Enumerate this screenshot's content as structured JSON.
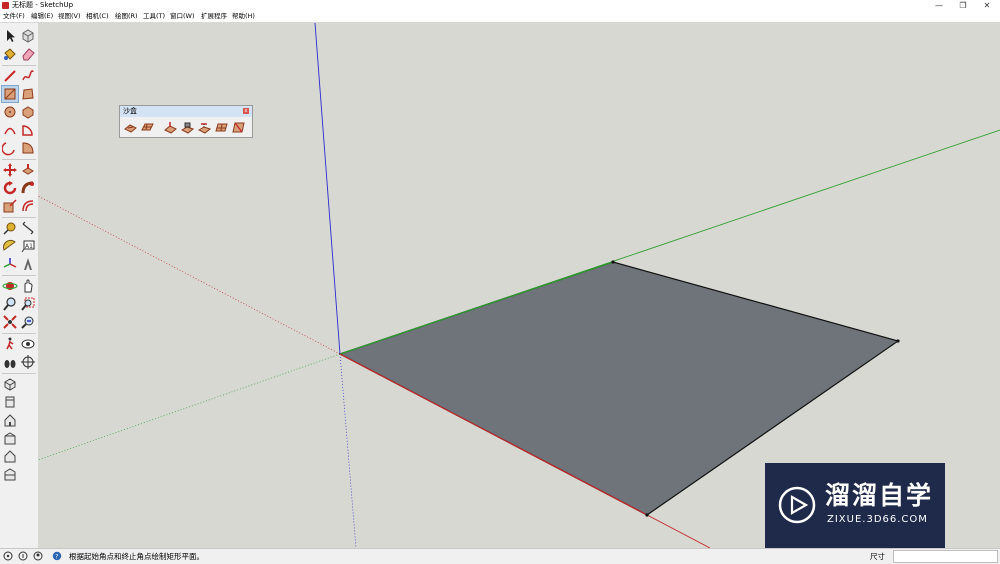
{
  "window": {
    "title": "无标题 - SketchUp",
    "controls": {
      "minimize": "—",
      "restore": "❐",
      "close": "✕"
    }
  },
  "menu": [
    "文件(F)",
    "编辑(E)",
    "视图(V)",
    "相机(C)",
    "绘图(R)",
    "工具(T)",
    "窗口(W)",
    "扩展程序",
    "帮助(H)"
  ],
  "toolbar": {
    "tools": [
      "select-icon",
      "component-icon",
      "paint-bucket-icon",
      "eraser-icon",
      "line-icon",
      "freehand-icon",
      "rectangle-icon",
      "rotated-rectangle-icon",
      "circle-icon",
      "polygon-icon",
      "arc-icon",
      "pie-icon",
      "two-point-arc-icon",
      "three-point-arc-icon",
      "move-icon",
      "push-pull-icon",
      "rotate-icon",
      "follow-me-icon",
      "scale-icon",
      "offset-icon",
      "tape-measure-icon",
      "dimension-icon",
      "protractor-icon",
      "text-icon",
      "axes-icon",
      "3d-text-icon",
      "orbit-icon",
      "pan-icon",
      "zoom-icon",
      "zoom-window-icon",
      "zoom-extents-icon",
      "previous-view-icon",
      "walk-icon",
      "look-around-icon",
      "position-camera-icon",
      "section-plane-icon",
      "iso-view-icon",
      "top-view-icon",
      "front-view-icon",
      "right-view-icon",
      "back-view-icon",
      "left-view-icon"
    ],
    "active_tool": "rectangle-icon"
  },
  "sandbox_panel": {
    "title": "沙盒",
    "close": "x",
    "tools": [
      "from-contours-icon",
      "from-scratch-icon",
      "smoove-icon",
      "stamp-icon",
      "drape-icon",
      "add-detail-icon",
      "flip-edge-icon"
    ]
  },
  "statusbar": {
    "message": "根据起始角点和终止角点绘制矩形平面。",
    "measurement_label": "尺寸",
    "measurement_value": ""
  },
  "watermark": {
    "brand": "溜溜自学",
    "url": "ZIXUE.3D66.COM"
  },
  "colors": {
    "viewport_bg": "#d8d8d3",
    "face": "#6e747a",
    "red_axis": "#c62828",
    "green_axis": "#2e9e2e",
    "blue_axis": "#2a2acf",
    "active_highlight": "#bcd3ea",
    "watermark_bg": "#1f2a4a"
  }
}
